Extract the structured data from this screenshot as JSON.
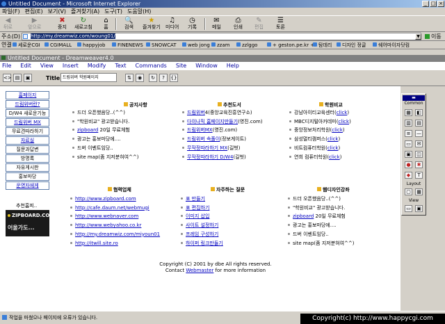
{
  "window": {
    "title": "Untitled Document - Microsoft Internet Explorer"
  },
  "menu": [
    "파일(F)",
    "편집(E)",
    "보기(V)",
    "즐겨찾기(A)",
    "도구(T)",
    "도움말(H)"
  ],
  "toolbar": {
    "back": "뒤로",
    "forward": "앞으로",
    "stop": "중지",
    "refresh": "새로고침",
    "home": "홈",
    "search": "검색",
    "favorites": "즐겨찾기",
    "media": "미디어",
    "history": "기록",
    "mail": "메일",
    "print": "인쇄",
    "edit": "편집",
    "discuss": "토론"
  },
  "address": {
    "label": "주소(D)",
    "url": "http://my.dreamwiz.com/woung01/",
    "go": "이동"
  },
  "links": {
    "label": "연결",
    "items": [
      "세로운CGI",
      "CGIMALL",
      "happyjob",
      "FINENEWS",
      "SNOWCAT",
      "web jong",
      "zzam",
      "zzlggo",
      "+ geston.pe.kr +",
      "탐데리",
      "디자인 정글",
      "쉐어마이자닷컴"
    ]
  },
  "dreamweaver": {
    "title": "Untitled Document - Dreamweaver4.0",
    "menu": [
      "File",
      "Edit",
      "View",
      "Insert",
      "Modify",
      "Text",
      "Commands",
      "Site",
      "Window",
      "Help"
    ],
    "title_label": "Title:",
    "title_value": "드림위버 학원페이지"
  },
  "nav": [
    {
      "label": "홈페이지",
      "link": true
    },
    {
      "label": "드림위버란?",
      "link": true
    },
    {
      "label": "D/W4 새로운기능",
      "link": false
    },
    {
      "label": "드림위버 MX",
      "link": true
    },
    {
      "label": "무료견따라하기",
      "link": false
    },
    {
      "label": "자료실",
      "link": true
    },
    {
      "label": "질문과답변",
      "link": false
    },
    {
      "label": "방명록",
      "link": false
    },
    {
      "label": "자유게시판",
      "link": false
    },
    {
      "label": "홍보마당",
      "link": false
    },
    {
      "label": "운영자에게",
      "link": true
    }
  ],
  "partner": {
    "label": "추천홈피..",
    "banner_top": "ZIPBOARD.COM",
    "banner_bottom": "어울가도..."
  },
  "sections": {
    "notice": {
      "title": "공지사항",
      "items": [
        {
          "text": "드더 오픈했음당..(^^)",
          "link": false
        },
        {
          "text": "\"학원비교\" 광고받습니다.",
          "link": false
        },
        {
          "lead": "zipboard",
          "text": " 20일 무료체험",
          "link": true
        },
        {
          "text": "광고는 홍보마당에....",
          "link": false
        },
        {
          "text": "드버 이벤트임당..",
          "link": false
        },
        {
          "text": "site map(좀 지저분혀여^^)",
          "link": false
        }
      ]
    },
    "books": {
      "title": "추천도서",
      "items": [
        {
          "lead": "드림위버",
          "text": "4(중앙교육진흥연구소)"
        },
        {
          "lead": "다이나믹 홈페이지만들기",
          "text": "(영진.com)"
        },
        {
          "lead": "드림위버MX",
          "text": "(영진.com)"
        },
        {
          "lead": "드림위버 속풀이",
          "text": "(정보게이트)"
        },
        {
          "lead": "무작정따라하기 MX",
          "text": "(길벗)"
        },
        {
          "lead": "무작정따라하기 D/W4",
          "text": "(길벗)"
        }
      ]
    },
    "schools": {
      "title": "학원비교",
      "click": "click",
      "items": [
        "강남아이티교육센터",
        "MBC디지털아카데미",
        "중앙정보처리학원",
        "삼성멀티캠퍼스",
        "비트컴퓨터학원",
        "연희 컴퓨터학원"
      ]
    },
    "partners": {
      "title": "협력업체",
      "items": [
        "http://www.zipboard.com",
        "http://cafe.daum.net/webmugi",
        "http://www.webnaver.com",
        "http://www.webyahoo.co.kr",
        "http://my.dreamwiz.com/miyoun01",
        "http://itwill.site.ro"
      ]
    },
    "faq": {
      "title": "자주하는 질문",
      "items": [
        "표 만들기",
        "표 편집하기",
        "이미지 삽입",
        "사이트 설정하기",
        "프레임 구성하기",
        "하이퍼 링크만들기"
      ]
    },
    "design": {
      "title": "웹디자인강좌",
      "items": [
        {
          "text": "드더 오픈했음당..(^^)",
          "link": false
        },
        {
          "text": "\"학원비교\" 광고받습니다.",
          "link": false
        },
        {
          "lead": "zipboard",
          "text": " 20일 무료체험",
          "link": true
        },
        {
          "text": "광고는 홍보마당에....",
          "link": false
        },
        {
          "text": "드버 이벤트임당..",
          "link": false
        },
        {
          "text": "site map(좀 지저분혀여^^)",
          "link": false
        }
      ]
    }
  },
  "footer": {
    "line1": "Copyright (C) 2001 by dbe All rights reserved.",
    "contact_prefix": "Contact ",
    "webmaster": "Webmaster",
    "contact_suffix": " for more information"
  },
  "objects_panel": {
    "common": "Common",
    "layout": "Layout",
    "view": "View"
  },
  "status": {
    "text": "작업을 마쳤으나 페이지에 오류가 있습니다."
  },
  "watermark": "Copyright(c) http://www.happycgi.com"
}
